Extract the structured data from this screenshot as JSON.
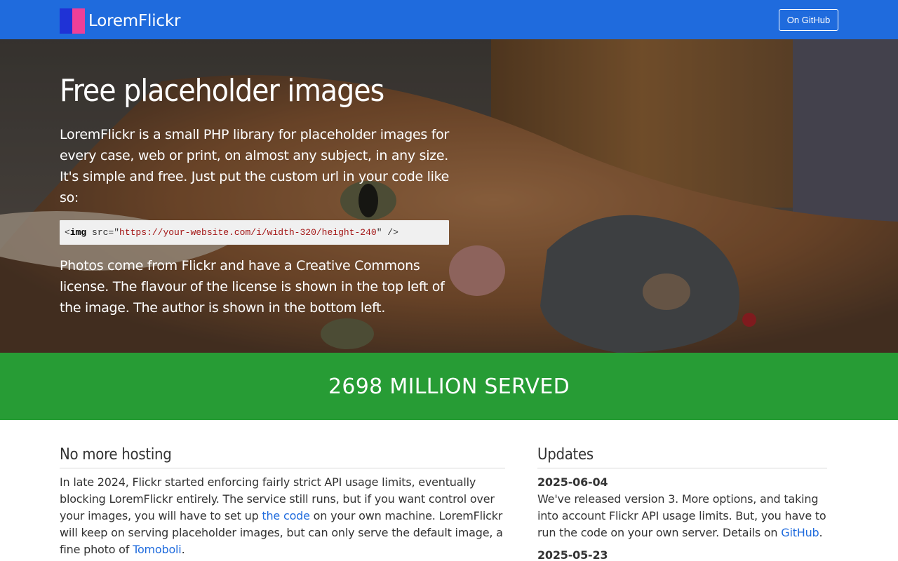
{
  "navbar": {
    "brand": "LoremFlickr",
    "github_button": "On GitHub",
    "colors": {
      "background": "#1f6bdd",
      "logo_left": "#1f32d6",
      "logo_right": "#ee3f98"
    }
  },
  "hero": {
    "title": "Free placeholder images",
    "intro": "LoremFlickr is a small PHP library for placeholder images for every case, web or print, on almost any subject, in any size. It's simple and free. Just put the custom url in your code like so:",
    "code": {
      "open": "<",
      "tag": "img",
      "attr": " src=\"",
      "url": "https://your-website.com/i/width-320/height-240",
      "close": "\" />"
    },
    "license_note": "Photos come from Flickr and have a Creative Commons license. The flavour of the license is shown in the top left of the image. The author is shown in the bottom left."
  },
  "served": {
    "text": "2698 MILLION SERVED",
    "color": "#279c35"
  },
  "no_more_hosting": {
    "title": "No more hosting",
    "text_1": "In late 2024, Flickr started enforcing fairly strict API usage limits, eventually blocking LoremFlickr entirely. The service still runs, but if you want control over your images, you will have to set up ",
    "link_code": "the code",
    "text_2": " on your own machine. LoremFlickr will keep on serving placeholder images, but can only serve the default image, a fine photo of ",
    "link_tomoboli": "Tomoboli",
    "text_3": "."
  },
  "updates": {
    "title": "Updates",
    "items": [
      {
        "date": "2025-06-04",
        "text_1": "We've released version 3. More options, and taking into account Flickr API usage limits. But, you have to run the code on your own server. Details on ",
        "link": "GitHub",
        "text_2": "."
      },
      {
        "date": "2025-05-23"
      }
    ]
  }
}
